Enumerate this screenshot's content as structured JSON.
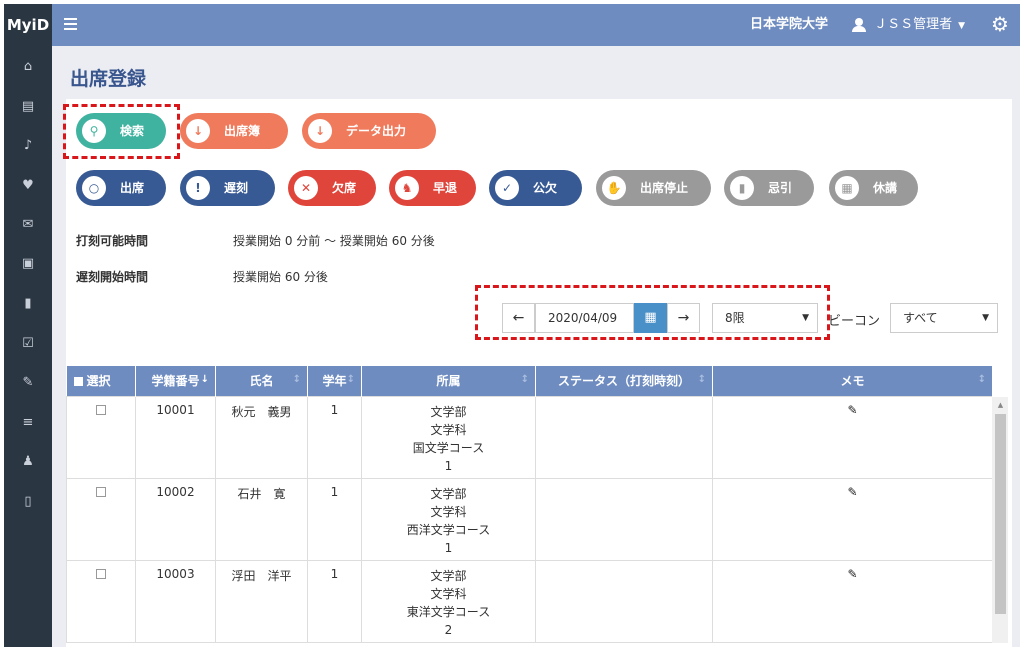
{
  "app": {
    "logo": "MyiD"
  },
  "header": {
    "university": "日本学院大学",
    "user": "ＪＳＳ管理者",
    "user_caret": "▼",
    "settings_icon": "gear-icon"
  },
  "sidebar": {
    "icons": [
      "home-icon",
      "id-card-icon",
      "bell-icon",
      "heartbeat-icon",
      "envelope-icon",
      "train-icon",
      "book-icon",
      "calendar-check-icon",
      "pencil-icon",
      "database-icon",
      "user-lock-icon",
      "mobile-icon"
    ]
  },
  "page": {
    "title": "出席登録"
  },
  "actions": {
    "search": "検索",
    "attendance_book": "出席簿",
    "data_export": "データ出力"
  },
  "status_buttons": {
    "present": "出席",
    "late": "遅刻",
    "absent": "欠席",
    "early_leave": "早退",
    "official_absence": "公欠",
    "attendance_stop": "出席停止",
    "bereavement": "忌引",
    "cancelled": "休講"
  },
  "info": {
    "stamp_time_label": "打刻可能時間",
    "stamp_time_value": "授業開始 0 分前 ～ 授業開始 60 分後",
    "late_start_label": "遅刻開始時間",
    "late_start_value": "授業開始 60 分後"
  },
  "filters": {
    "prev": "←",
    "date": "2020/04/09",
    "next": "→",
    "period": "8限",
    "beacon_label": "ビーコン",
    "beacon_value": "すべて"
  },
  "table": {
    "headers": {
      "select": "選択",
      "student_id": "学籍番号",
      "name": "氏名",
      "year": "学年",
      "affiliation": "所属",
      "status": "ステータス（打刻時刻）",
      "memo": "メモ"
    },
    "rows": [
      {
        "student_id": "10001",
        "name": "秋元　義男",
        "year": "1",
        "faculty": "文学部",
        "department": "文学科",
        "course": "国文学コース",
        "aff_year": "1",
        "status": ""
      },
      {
        "student_id": "10002",
        "name": "石井　寛",
        "year": "1",
        "faculty": "文学部",
        "department": "文学科",
        "course": "西洋文学コース",
        "aff_year": "1",
        "status": ""
      },
      {
        "student_id": "10003",
        "name": "浮田　洋平",
        "year": "1",
        "faculty": "文学部",
        "department": "文学科",
        "course": "東洋文学コース",
        "aff_year": "2",
        "status": ""
      }
    ]
  },
  "colors": {
    "topbar": "#6f8cc0",
    "sidebar": "#2b3643",
    "teal": "#40b3a0",
    "orange": "#f07b5c",
    "navy": "#385a94",
    "red": "#e0453b",
    "gray": "#9a9a9a",
    "highlight": "#d9171b"
  }
}
